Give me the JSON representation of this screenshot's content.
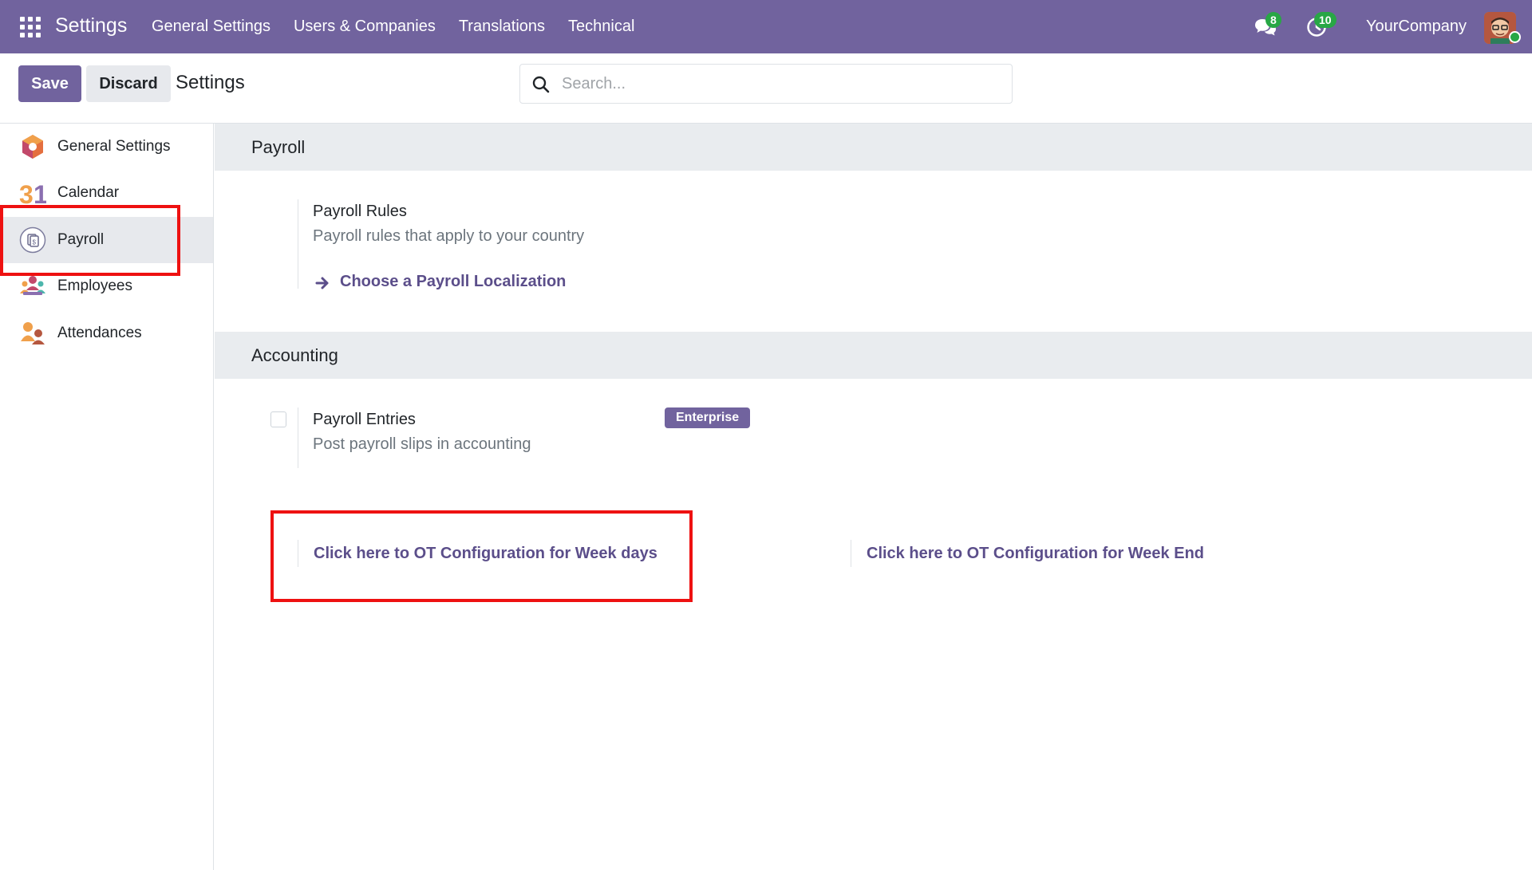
{
  "navbar": {
    "brand": "Settings",
    "menu": [
      "General Settings",
      "Users & Companies",
      "Translations",
      "Technical"
    ],
    "messages_count": "8",
    "activities_count": "10",
    "company": "YourCompany",
    "colors": {
      "bar": "#71639e",
      "badge": "#28a745"
    }
  },
  "control_panel": {
    "save_label": "Save",
    "discard_label": "Discard",
    "title": "Settings",
    "search_placeholder": "Search..."
  },
  "sidebar": {
    "items": [
      {
        "label": "General Settings",
        "icon": "general-settings-icon",
        "active": false
      },
      {
        "label": "Calendar",
        "icon": "calendar-icon",
        "active": false
      },
      {
        "label": "Payroll",
        "icon": "payroll-icon",
        "active": true
      },
      {
        "label": "Employees",
        "icon": "employees-icon",
        "active": false
      },
      {
        "label": "Attendances",
        "icon": "attendances-icon",
        "active": false
      }
    ]
  },
  "sections": {
    "payroll": {
      "title": "Payroll",
      "rules_title": "Payroll Rules",
      "rules_desc": "Payroll rules that apply to your country",
      "localization_link": "Choose a Payroll Localization"
    },
    "accounting": {
      "title": "Accounting",
      "entries_title": "Payroll Entries",
      "entries_desc": "Post payroll slips in accounting",
      "entries_checked": false,
      "enterprise_badge": "Enterprise",
      "ot_weekdays_link": "Click here to OT Configuration for Week days",
      "ot_weekend_link": "Click here to OT Configuration for Week End"
    }
  }
}
